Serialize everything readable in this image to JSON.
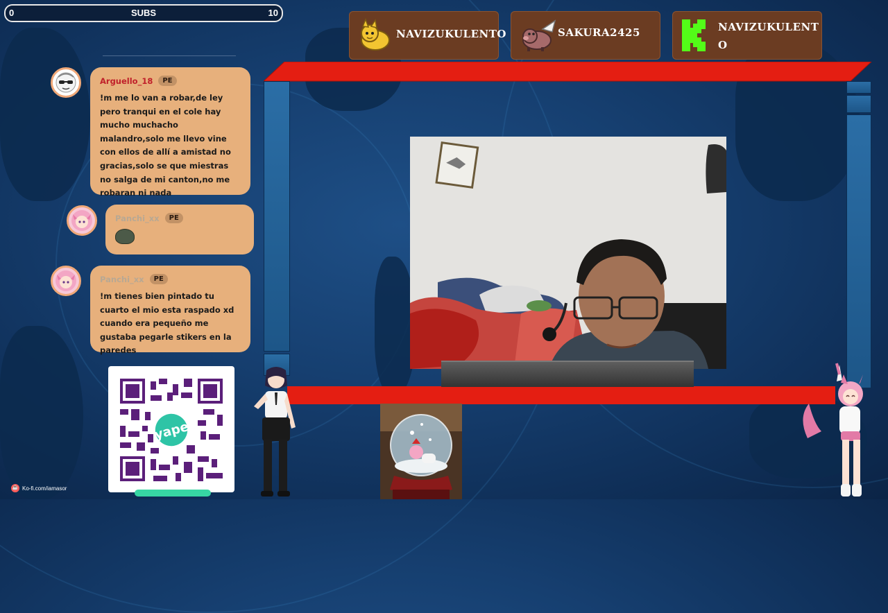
{
  "subs": {
    "min": "0",
    "label": "SUBS",
    "max": "10",
    "progress": 0
  },
  "chat": [
    {
      "user": "Arguello_18",
      "badge": "PE",
      "text": "!m me lo van a robar,de ley pero tranqui en el cole hay mucho muchacho malandro,solo me llevo vine con ellos de allí a amistad no gracias,solo se que miestras no salga de mi canton,no me robaran ni nada",
      "avatar_icon": "sunglasses-avatar-icon"
    },
    {
      "user": "Panchi_xx",
      "badge": "PE",
      "text": "",
      "emote_icon": "emote-icon",
      "avatar_icon": "anime-girl-avatar-icon"
    },
    {
      "user": "Panchi_xx",
      "badge": "PE",
      "text": "!m tienes bien pintado tu cuarto el mio esta raspado xd cuando era pequeño me gustaba pegarle stikers en la paredes",
      "avatar_icon": "anime-girl-avatar-icon"
    }
  ],
  "top_cards": [
    {
      "name": "NAVIZUKULENTO",
      "icon": "yellow-creature-icon"
    },
    {
      "name": "SAKURA2425",
      "icon": "winged-pig-icon"
    },
    {
      "name": "NAVIZUKULENTO",
      "icon": "kick-logo-icon"
    }
  ],
  "qr": {
    "brand": "yape"
  },
  "kofi": {
    "text": "Ko-fi.com/iamasor"
  },
  "colors": {
    "bubble": "#e7b07c",
    "card": "#6b3c22",
    "frame_red": "#e41e12",
    "kick_green": "#53fc18"
  }
}
